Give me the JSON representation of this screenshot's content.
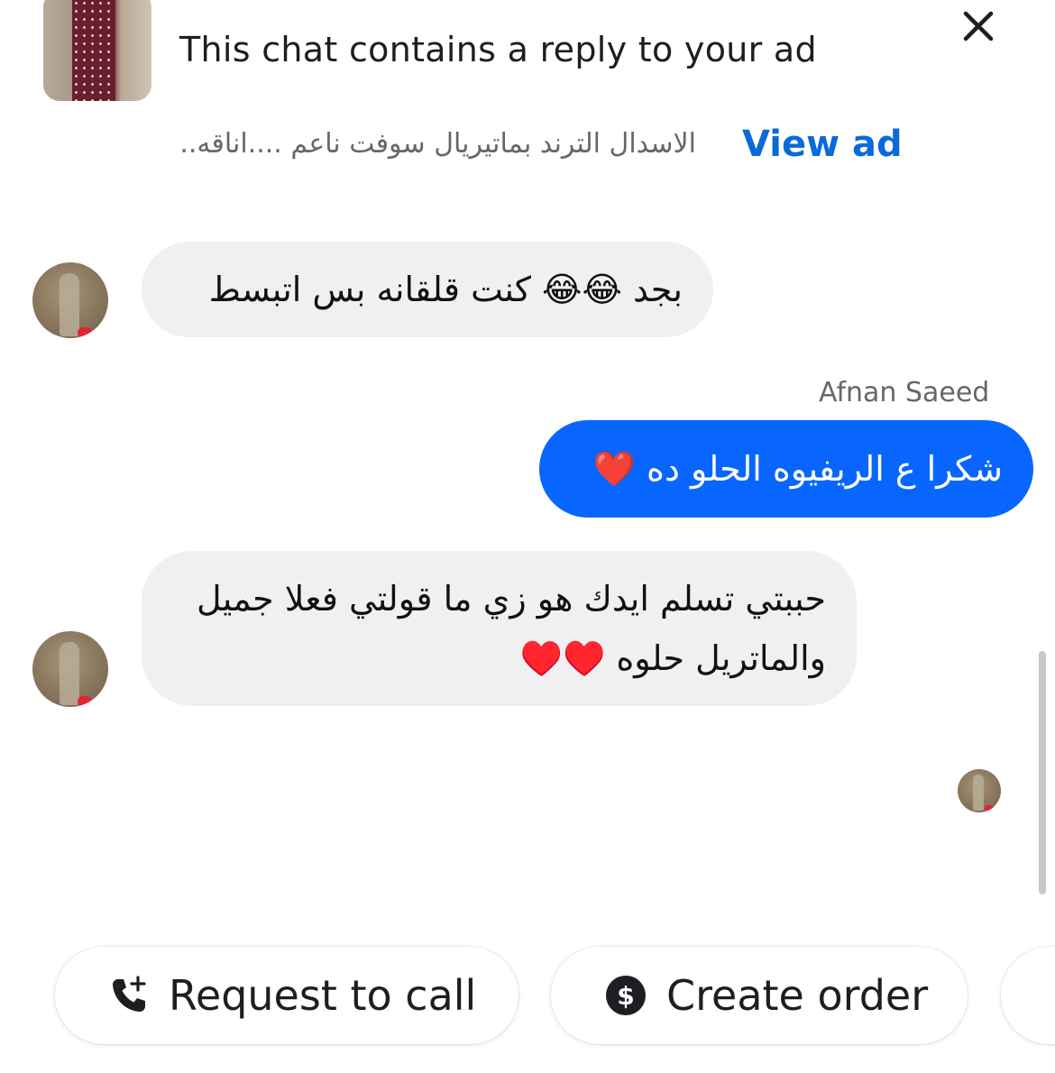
{
  "ad_banner": {
    "title": "This chat contains a reply to your ad",
    "snippet": "الاسدال الترند بماتيريال سوفت ناعم ....اناقه...",
    "view_ad_label": "View ad"
  },
  "messages": [
    {
      "direction": "incoming",
      "text": "بجد 😂😂 كنت قلقانه بس اتبسط"
    },
    {
      "direction": "outgoing",
      "sender": "Afnan Saeed",
      "text": "شكرا ع الريفيوه الحلو ده ❤️"
    },
    {
      "direction": "incoming",
      "lines": [
        "حببتي تسلم ايدك هو زي ما قولتي فعلا جميل",
        "والماتريل حلوه ♥️♥️"
      ]
    }
  ],
  "quick_actions": {
    "request_call_label": "Request to call",
    "create_order_label": "Create order"
  },
  "colors": {
    "accent_blue": "#0866ff",
    "link_blue": "#0a6ad8",
    "incoming_bubble": "#f0f0f3"
  }
}
